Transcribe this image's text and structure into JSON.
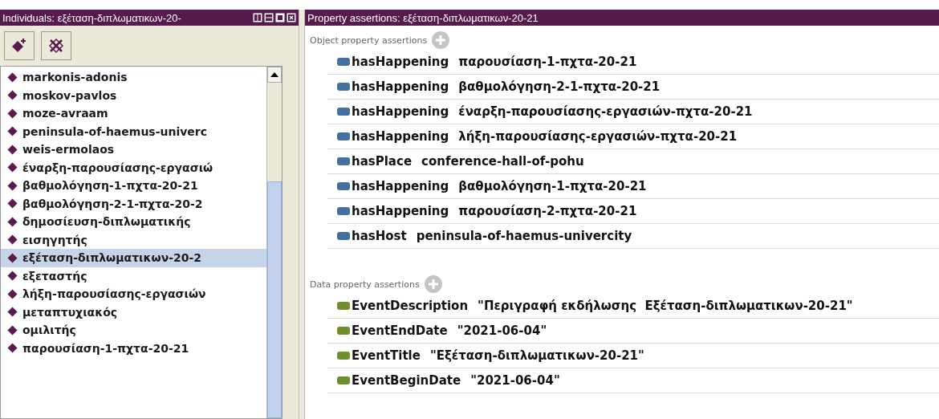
{
  "individuals_panel": {
    "title": "Individuals: εξέταση-διπλωματικων-20-",
    "items": [
      {
        "label": "markonis-adonis",
        "selected": false
      },
      {
        "label": "moskov-pavlos",
        "selected": false
      },
      {
        "label": "moze-avraam",
        "selected": false
      },
      {
        "label": "peninsula-of-haemus-univerc",
        "selected": false
      },
      {
        "label": "weis-ermolaos",
        "selected": false
      },
      {
        "label": "έναρξη-παρουσίασης-εργασιώ",
        "selected": false
      },
      {
        "label": "βαθμολόγηση-1-πχτα-20-21",
        "selected": false
      },
      {
        "label": "βαθμολόγηση-2-1-πχτα-20-2",
        "selected": false
      },
      {
        "label": "δημοσίευση-διπλωματικής",
        "selected": false
      },
      {
        "label": "εισηγητής",
        "selected": false
      },
      {
        "label": "εξέταση-διπλωματικων-20-2",
        "selected": true
      },
      {
        "label": "εξεταστής",
        "selected": false
      },
      {
        "label": "λήξη-παρουσίασης-εργασιών",
        "selected": false
      },
      {
        "label": "μεταπτυχιακός",
        "selected": false
      },
      {
        "label": "ομιλιτής",
        "selected": false
      },
      {
        "label": "παρουσίαση-1-πχτα-20-21",
        "selected": false
      }
    ]
  },
  "property_panel": {
    "title": "Property assertions: εξέταση-διπλωματικων-20-21",
    "sections": [
      {
        "kind": "object",
        "label": "Object property assertions",
        "assertions": [
          {
            "property": "hasHappening",
            "value": "παρουσίαση-1-πχτα-20-21"
          },
          {
            "property": "hasHappening",
            "value": "βαθμολόγηση-2-1-πχτα-20-21"
          },
          {
            "property": "hasHappening",
            "value": "έναρξη-παρουσίασης-εργασιών-πχτα-20-21"
          },
          {
            "property": "hasHappening",
            "value": "λήξη-παρουσίασης-εργασιών-πχτα-20-21"
          },
          {
            "property": "hasPlace",
            "value": "conference-hall-of-pohu"
          },
          {
            "property": "hasHappening",
            "value": "βαθμολόγηση-1-πχτα-20-21"
          },
          {
            "property": "hasHappening",
            "value": "παρουσίαση-2-πχτα-20-21"
          },
          {
            "property": "hasHost",
            "value": "peninsula-of-haemus-univercity"
          }
        ]
      },
      {
        "kind": "data",
        "label": "Data property assertions",
        "assertions": [
          {
            "property": "EventDescription",
            "value": "\"Περιγραφή εκδήλωσης  Εξέταση-διπλωματικων-20-21\""
          },
          {
            "property": "EventEndDate",
            "value": "\"2021-06-04\""
          },
          {
            "property": "EventTitle",
            "value": "\"Εξέταση-διπλωματικων-20-21\""
          },
          {
            "property": "EventBeginDate",
            "value": "\"2021-06-04\""
          }
        ]
      }
    ]
  }
}
